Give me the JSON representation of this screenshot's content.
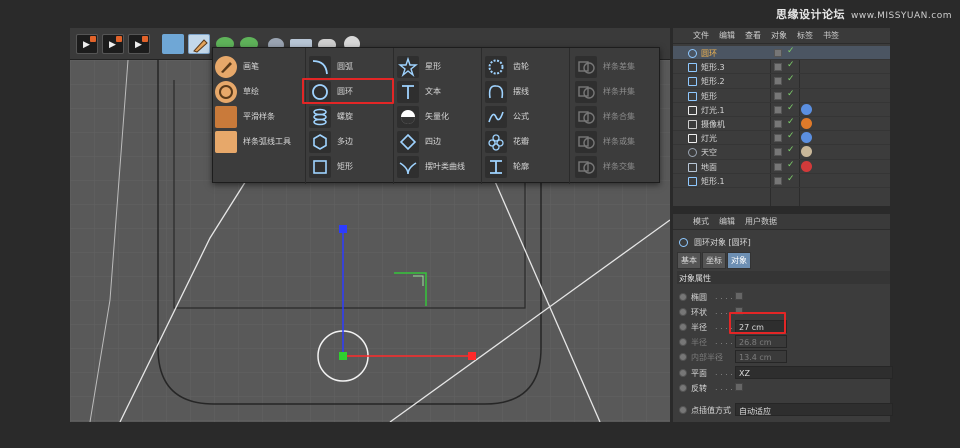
{
  "watermark": {
    "main": "思缘设计论坛",
    "url": "www.MISSYUAN.com"
  },
  "menu": {
    "col0": [
      "画笔",
      "草绘",
      "平滑样条",
      "样条弧线工具"
    ],
    "col1": [
      "圆弧",
      "圆环",
      "螺旋",
      "多边",
      "矩形"
    ],
    "col2": [
      "星形",
      "文本",
      "矢量化",
      "四边",
      "摆叶类曲线"
    ],
    "col3": [
      "齿轮",
      "摆线",
      "公式",
      "花瓣",
      "轮廓"
    ],
    "col4": [
      "样条差集",
      "样条并集",
      "样条合集",
      "样条或集",
      "样条交集"
    ]
  },
  "objects": {
    "tabs": [
      "文件",
      "编辑",
      "查看",
      "对象",
      "标签",
      "书签"
    ],
    "rows": [
      {
        "name": "圆环",
        "icon": "circle-spline",
        "selected": true
      },
      {
        "name": "矩形.3",
        "icon": "spline"
      },
      {
        "name": "矩形.2",
        "icon": "spline"
      },
      {
        "name": "矩形",
        "icon": "spline"
      },
      {
        "name": "灯光.1",
        "icon": "light",
        "tag": "target"
      },
      {
        "name": "摄像机",
        "icon": "camera",
        "tag": "protect"
      },
      {
        "name": "灯光",
        "icon": "light",
        "tag": "target"
      },
      {
        "name": "天空",
        "icon": "sky",
        "tag": "texture"
      },
      {
        "name": "地面",
        "icon": "floor",
        "tag": "material"
      },
      {
        "name": "矩形.1",
        "icon": "spline"
      }
    ]
  },
  "attributes": {
    "tabs": [
      "模式",
      "编辑",
      "用户数据"
    ],
    "title": "圆环对象 [圆环]",
    "subtabs": [
      "基本",
      "坐标",
      "对象"
    ],
    "section": "对象属性",
    "props": [
      {
        "label": "椭圆",
        "dots": ". . . . .",
        "type": "check"
      },
      {
        "label": "环状",
        "dots": ". . . . .",
        "type": "check"
      },
      {
        "label": "半径",
        "dots": ". . . . .",
        "type": "value",
        "value": "27 cm"
      },
      {
        "label": "半径",
        "dots": ". . . . .",
        "type": "value",
        "value": "26.8 cm",
        "dim": true
      },
      {
        "label": "内部半径",
        "dots": ". .",
        "type": "value",
        "value": "13.4 cm",
        "dim": true
      },
      {
        "label": "平面",
        "dots": ". . . . .",
        "type": "select",
        "value": "XZ"
      },
      {
        "label": "反转",
        "dots": ". . . . .",
        "type": "check"
      },
      {
        "label": "点插值方式",
        "dots": "",
        "type": "select",
        "value": "自动适应"
      }
    ]
  },
  "colors": {
    "accent_red": "#e32626",
    "selected_text": "#f0b450",
    "viewport_bg": "#595959",
    "axis_y": "#2d3cff",
    "axis_x": "#ff2a2a",
    "axis_center": "#2fd02f"
  }
}
